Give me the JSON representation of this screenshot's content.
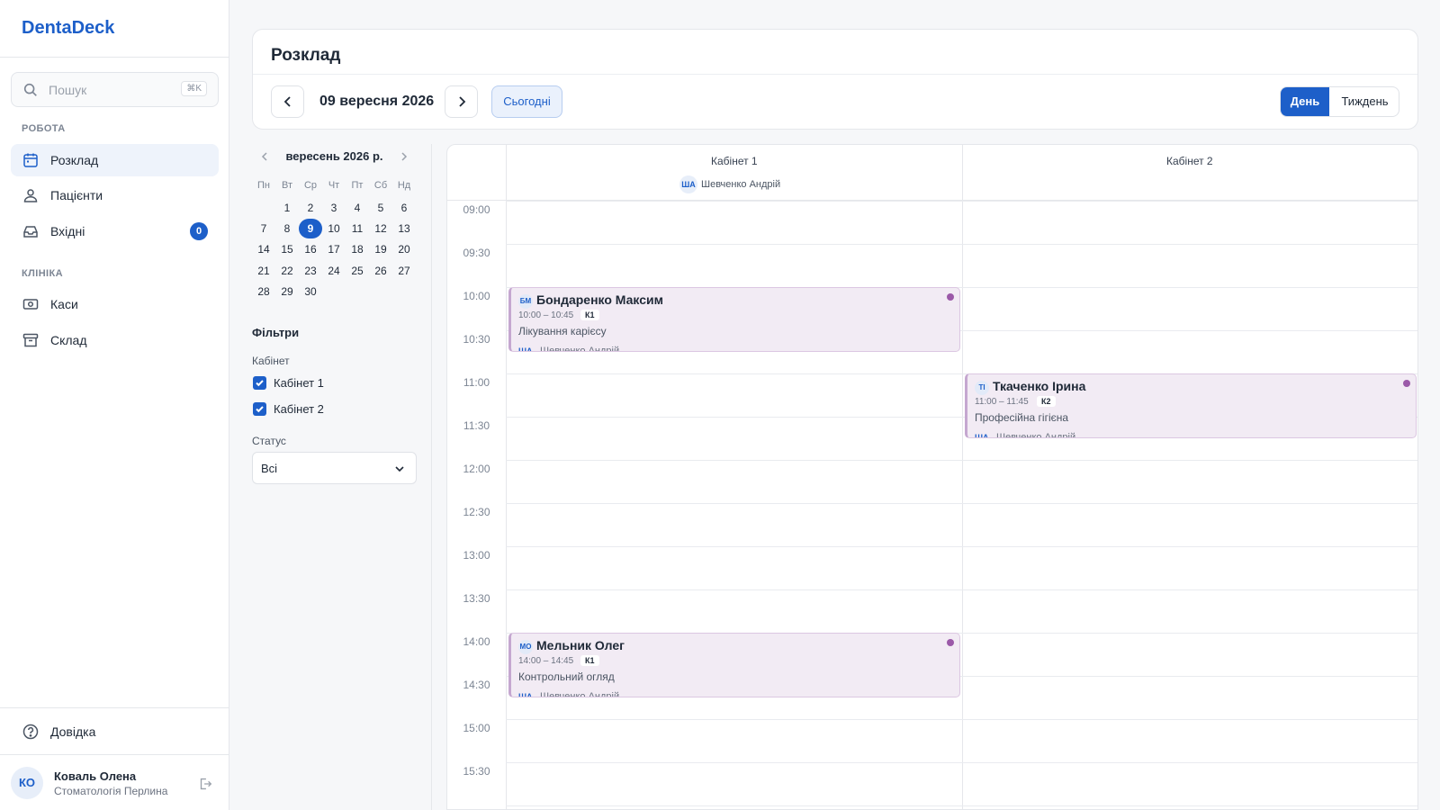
{
  "app": {
    "brand": "DentaDeck"
  },
  "search": {
    "placeholder": "Пошук",
    "shortcut": "⌘K"
  },
  "sidebar": {
    "section_work": "РОБОТА",
    "section_clinic": "КЛІНІКА",
    "items": [
      {
        "label": "Розклад",
        "icon": "calendar-icon",
        "active": true
      },
      {
        "label": "Пацієнти",
        "icon": "users-icon"
      },
      {
        "label": "Вхідні",
        "icon": "inbox-icon",
        "badge": "0"
      },
      {
        "label": "Каси",
        "icon": "cash-icon"
      },
      {
        "label": "Склад",
        "icon": "archive-icon"
      }
    ],
    "help": "Довідка",
    "user": {
      "initials": "КО",
      "name": "Коваль Олена",
      "org": "Стоматологія Перлина"
    }
  },
  "header": {
    "title": "Розклад",
    "date": "09 вересня 2026",
    "today": "Сьогодні",
    "view_day": "День",
    "view_week": "Тиждень",
    "active_view": "day"
  },
  "mini_calendar": {
    "month": "вересень 2026 р.",
    "weekdays": [
      "Пн",
      "Вт",
      "Ср",
      "Чт",
      "Пт",
      "Сб",
      "Нд"
    ],
    "days": [
      "1",
      "2",
      "3",
      "4",
      "5",
      "6",
      "7",
      "8",
      "9",
      "10",
      "11",
      "12",
      "13",
      "14",
      "15",
      "16",
      "17",
      "18",
      "19",
      "20",
      "21",
      "22",
      "23",
      "24",
      "25",
      "26",
      "27",
      "28",
      "29",
      "30"
    ],
    "first_weekday_index": 1,
    "selected": "9"
  },
  "filters": {
    "title": "Фільтри",
    "cabinet_label": "Кабінет",
    "cabinets": [
      {
        "label": "Кабінет 1",
        "checked": true
      },
      {
        "label": "Кабінет 2",
        "checked": true
      }
    ],
    "status_label": "Статус",
    "status_value": "Всі"
  },
  "schedule": {
    "columns": [
      {
        "name": "Кабінет 1",
        "doctor_initials": "ША",
        "doctor": "Шевченко Андрій"
      },
      {
        "name": "Кабінет 2"
      }
    ],
    "times": [
      "09:00",
      "09:30",
      "10:00",
      "10:30",
      "11:00",
      "11:30",
      "12:00",
      "12:30",
      "13:00",
      "13:30",
      "14:00",
      "14:30",
      "15:00",
      "15:30"
    ],
    "appointments": [
      {
        "initials": "БМ",
        "patient": "Бондаренко Максим",
        "time": "10:00 – 10:45",
        "cabinet": "К1",
        "procedure": "Лікування карієсу",
        "doctor_initials": "ША",
        "doctor": "Шевченко Андрій",
        "column": 0,
        "start": "10:00",
        "status_color": "#9b59a8"
      },
      {
        "initials": "ТІ",
        "patient": "Ткаченко Ірина",
        "time": "11:00 – 11:45",
        "cabinet": "К2",
        "procedure": "Професійна гігієна",
        "doctor_initials": "ША",
        "doctor": "Шевченко Андрій",
        "column": 1,
        "start": "11:00",
        "status_color": "#9b59a8"
      },
      {
        "initials": "МО",
        "patient": "Мельник Олег",
        "time": "14:00 – 14:45",
        "cabinet": "К1",
        "procedure": "Контрольний огляд",
        "doctor_initials": "ША",
        "doctor": "Шевченко Андрій",
        "column": 0,
        "start": "14:00",
        "status_color": "#9b59a8"
      }
    ]
  },
  "colors": {
    "accent": "#1d5fc9",
    "appointment_bg": "#f2ebf4",
    "status_dot": "#9b59a8"
  }
}
